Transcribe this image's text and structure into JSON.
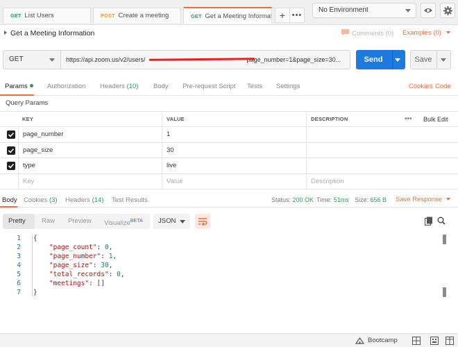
{
  "tabs": [
    {
      "method": "GET",
      "title": "List Users"
    },
    {
      "method": "POST",
      "title": "Create a meeting"
    },
    {
      "method": "GET",
      "title": "Get a Meeting Informat..."
    }
  ],
  "environment": {
    "selected": "No Environment"
  },
  "request": {
    "title": "Get a Meeting Information",
    "comments": "Comments (0)",
    "examples": "Examples (0)",
    "method": "GET",
    "url_prefix": "https://api.zoom.us/v2/users/",
    "url_suffix": "page_number=1&page_size=30...",
    "send_label": "Send",
    "save_label": "Save"
  },
  "request_tabs": {
    "params": "Params",
    "authorization": "Authorization",
    "headers": "Headers",
    "headers_count": "(10)",
    "body": "Body",
    "prerequest": "Pre-request Script",
    "tests": "Tests",
    "settings": "Settings",
    "cookies": "Cookies",
    "code": "Code"
  },
  "query_params": {
    "title": "Query Params",
    "headers": {
      "key": "KEY",
      "value": "VALUE",
      "description": "DESCRIPTION",
      "bulk_edit": "Bulk Edit"
    },
    "rows": [
      {
        "key": "page_number",
        "value": "1"
      },
      {
        "key": "page_size",
        "value": "30"
      },
      {
        "key": "type",
        "value": "live"
      }
    ],
    "placeholders": {
      "key": "Key",
      "value": "Value",
      "description": "Description"
    }
  },
  "response_tabs": {
    "body": "Body",
    "cookies": "Cookies",
    "cookies_count": "(3)",
    "headers": "Headers",
    "headers_count": "(14)",
    "test_results": "Test Results"
  },
  "response_status": {
    "status_label": "Status:",
    "status_value": "200 OK",
    "time_label": "Time:",
    "time_value": "51ms",
    "size_label": "Size:",
    "size_value": "656 B",
    "save_response": "Save Response"
  },
  "format_toolbar": {
    "pretty": "Pretty",
    "raw": "Raw",
    "preview": "Preview",
    "visualize": "Visualize",
    "beta": "BETA",
    "format": "JSON"
  },
  "response_body": {
    "line_numbers": [
      "1",
      "2",
      "3",
      "4",
      "5",
      "6",
      "7"
    ],
    "open_brace": "{",
    "fields": [
      {
        "key": "\"page_count\"",
        "value": "0"
      },
      {
        "key": "\"page_number\"",
        "value": "1"
      },
      {
        "key": "\"page_size\"",
        "value": "30"
      },
      {
        "key": "\"total_records\"",
        "value": "0"
      },
      {
        "key": "\"meetings\"",
        "value": "[]"
      }
    ],
    "close_brace": "}"
  },
  "status_bar": {
    "bootcamp": "Bootcamp"
  }
}
